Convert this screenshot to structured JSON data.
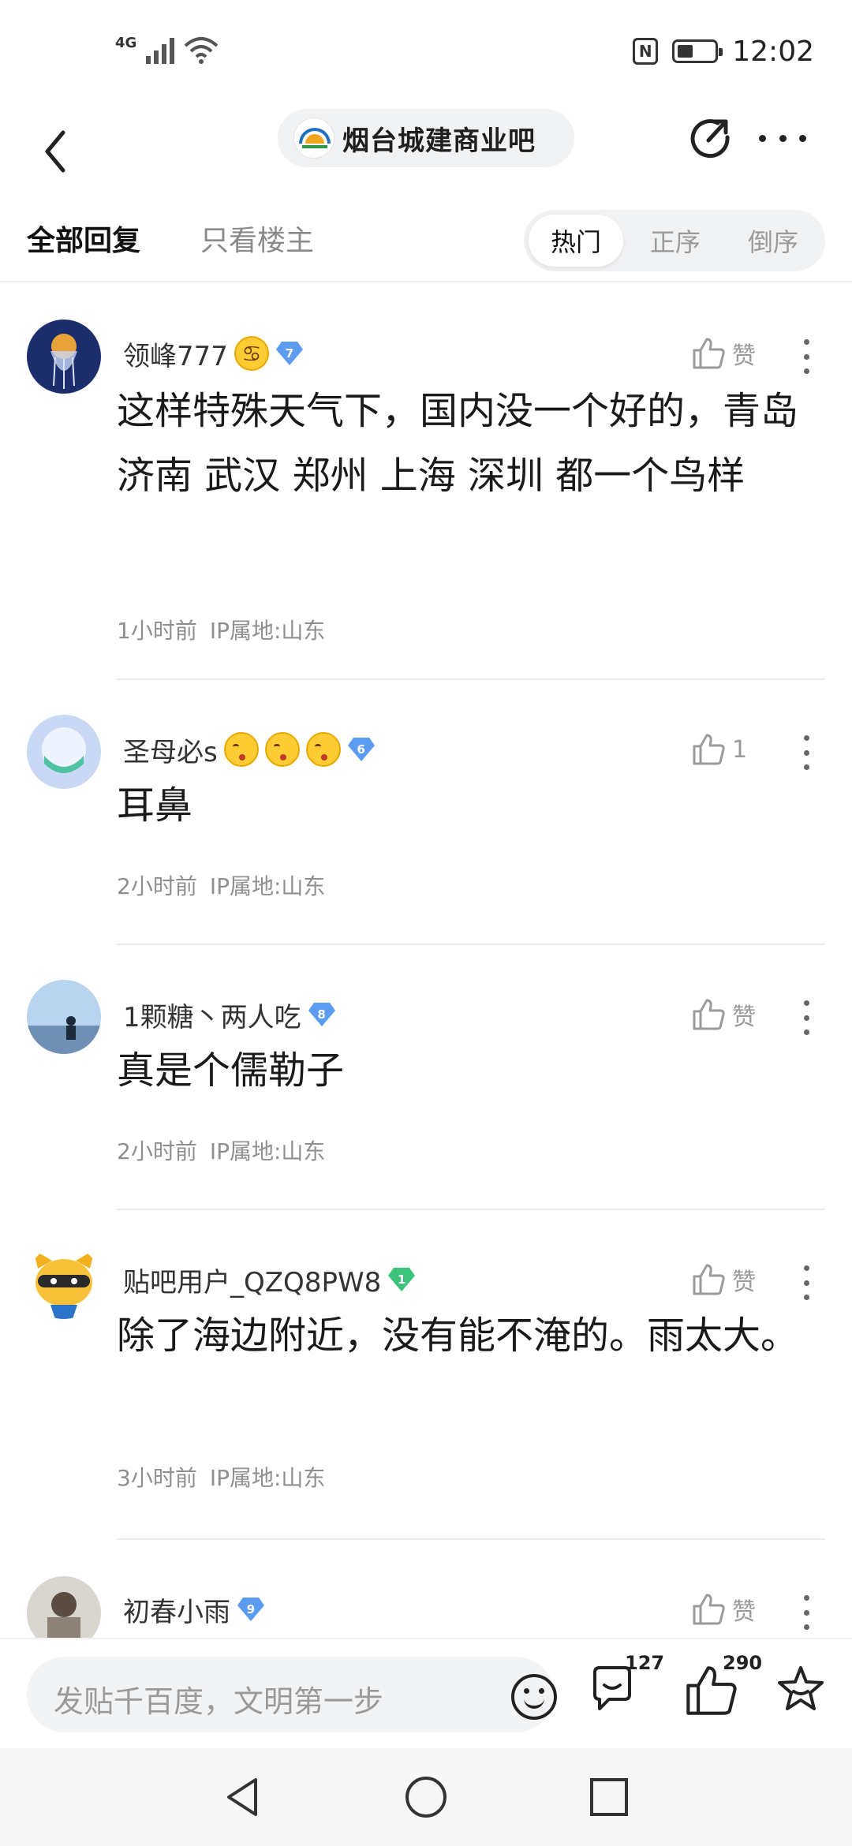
{
  "status_bar": {
    "network": "4G",
    "time": "12:02",
    "icons": [
      "signal-icon",
      "wifi-icon",
      "nfc-icon",
      "battery-icon"
    ]
  },
  "header": {
    "forum_name": "烟台城建商业吧",
    "icons": [
      "back-icon",
      "share-icon",
      "more-icon"
    ]
  },
  "tabs": {
    "all_replies": "全部回复",
    "owner_only": "只看楼主",
    "sort": {
      "hot": "热门",
      "asc": "正序",
      "desc": "倒序",
      "selected": "热门"
    }
  },
  "comments": [
    {
      "username": "领峰777",
      "level": "7",
      "level_color": "#5b9bf0",
      "like_label": "赞",
      "text": "这样特殊天气下，国内没一个好的，青岛 济南 武汉 郑州 上海 深圳 都一个鸟样",
      "time": "1小时前",
      "ip": "IP属地:山东"
    },
    {
      "username": "圣母必s",
      "level": "6",
      "level_color": "#5b9bf0",
      "like_label": "1",
      "text": "耳鼻",
      "time": "2小时前",
      "ip": "IP属地:山东"
    },
    {
      "username": "1颗糖丶两人吃",
      "level": "8",
      "level_color": "#5b9bf0",
      "like_label": "赞",
      "text": "真是个儒勒子",
      "time": "2小时前",
      "ip": "IP属地:山东"
    },
    {
      "username": "贴吧用户_QZQ8PW8",
      "level": "1",
      "level_color": "#3cc37a",
      "like_label": "赞",
      "text": "除了海边附近，没有能不淹的。雨太大。",
      "time": "3小时前",
      "ip": "IP属地:山东"
    },
    {
      "username": "初春小雨",
      "level": "9",
      "level_color": "#5b9bf0",
      "like_label": "赞"
    }
  ],
  "bottom_bar": {
    "placeholder": "发贴千百度，文明第一步",
    "comment_count": "127",
    "like_count": "290"
  }
}
